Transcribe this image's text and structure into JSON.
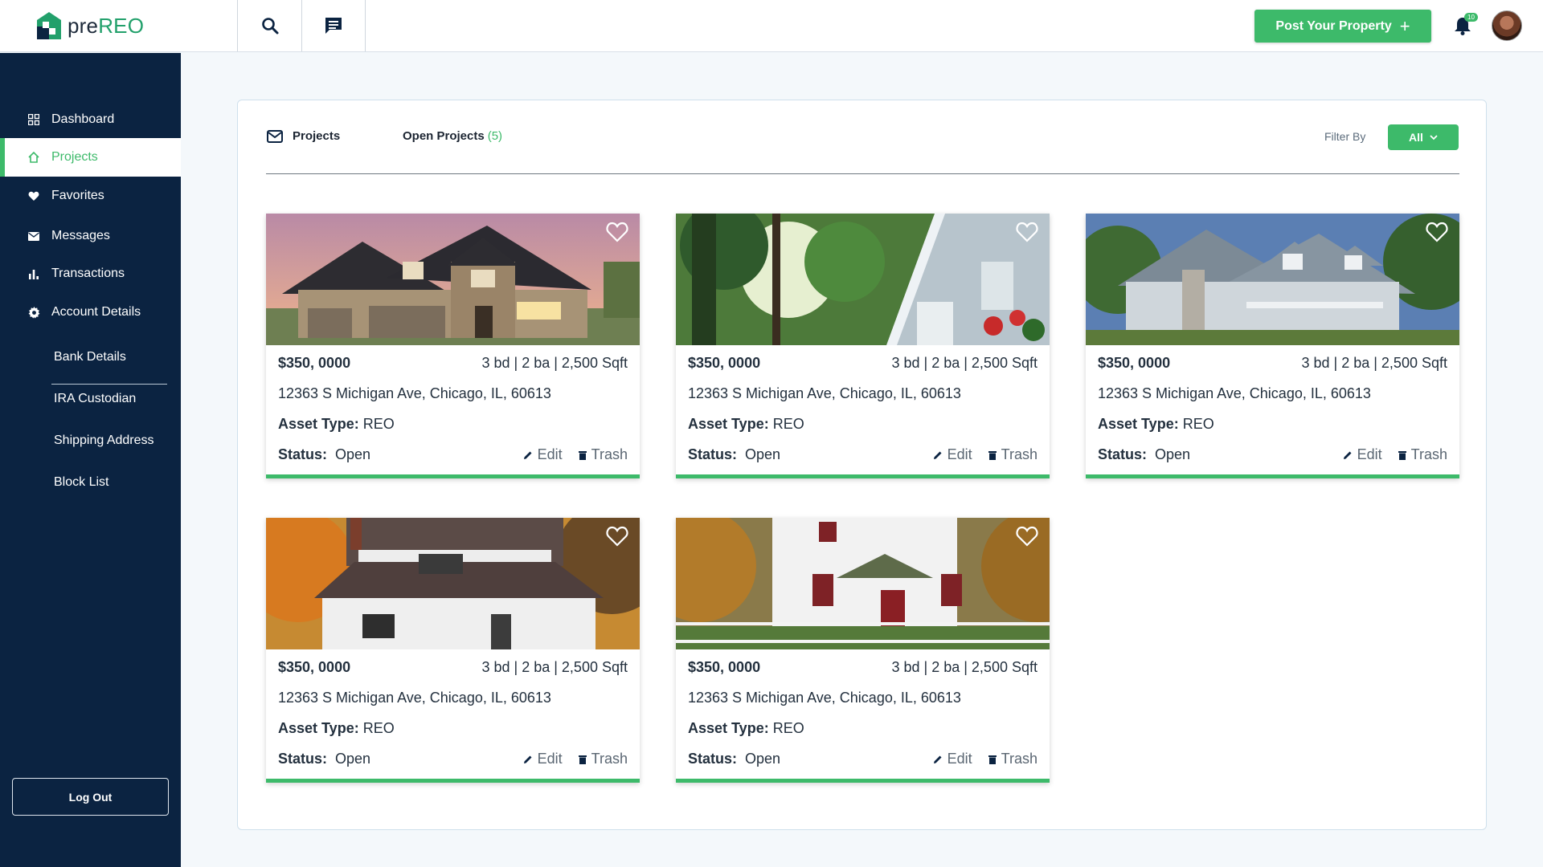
{
  "brand": {
    "pre": "pre",
    "reo": "REO"
  },
  "header": {
    "post_button": "Post Your Property",
    "notification_count": "10"
  },
  "sidebar": {
    "items": [
      {
        "label": "Dashboard",
        "icon": "dashboard-icon"
      },
      {
        "label": "Projects",
        "icon": "home-icon"
      },
      {
        "label": "Favorites",
        "icon": "heart-icon"
      },
      {
        "label": "Messages",
        "icon": "mail-icon"
      },
      {
        "label": "Transactions",
        "icon": "bar-chart-icon"
      },
      {
        "label": "Account Details",
        "icon": "gear-icon"
      }
    ],
    "sub_items": [
      "Bank Details",
      "IRA Custodian",
      "Shipping Address",
      "Block List"
    ],
    "logout": "Log Out"
  },
  "main": {
    "tab_projects": "Projects",
    "tab_open": "Open Projects",
    "tab_open_count": "(5)",
    "filter_label": "Filter By",
    "filter_value": "All",
    "cards": [
      {
        "price": "$350, 0000",
        "specs": "3 bd | 2 ba | 2,500 Sqft",
        "address": "12363 S Michigan Ave, Chicago, IL, 60613",
        "asset_label": "Asset Type:",
        "asset_value": "REO",
        "status_label": "Status:",
        "status_value": "Open",
        "edit": "Edit",
        "trash": "Trash"
      },
      {
        "price": "$350, 0000",
        "specs": "3 bd | 2 ba | 2,500 Sqft",
        "address": "12363 S Michigan Ave, Chicago, IL, 60613",
        "asset_label": "Asset Type:",
        "asset_value": "REO",
        "status_label": "Status:",
        "status_value": "Open",
        "edit": "Edit",
        "trash": "Trash"
      },
      {
        "price": "$350, 0000",
        "specs": "3 bd | 2 ba | 2,500 Sqft",
        "address": "12363 S Michigan Ave, Chicago, IL, 60613",
        "asset_label": "Asset Type:",
        "asset_value": "REO",
        "status_label": "Status:",
        "status_value": "Open",
        "edit": "Edit",
        "trash": "Trash"
      },
      {
        "price": "$350, 0000",
        "specs": "3 bd | 2 ba | 2,500 Sqft",
        "address": "12363 S Michigan Ave, Chicago, IL, 60613",
        "asset_label": "Asset Type:",
        "asset_value": "REO",
        "status_label": "Status:",
        "status_value": "Open",
        "edit": "Edit",
        "trash": "Trash"
      },
      {
        "price": "$350, 0000",
        "specs": "3 bd | 2 ba | 2,500 Sqft",
        "address": "12363 S Michigan Ave, Chicago, IL, 60613",
        "asset_label": "Asset Type:",
        "asset_value": "REO",
        "status_label": "Status:",
        "status_value": "Open",
        "edit": "Edit",
        "trash": "Trash"
      }
    ]
  },
  "colors": {
    "accent": "#3dba6a",
    "sidebar": "#0b2341"
  }
}
